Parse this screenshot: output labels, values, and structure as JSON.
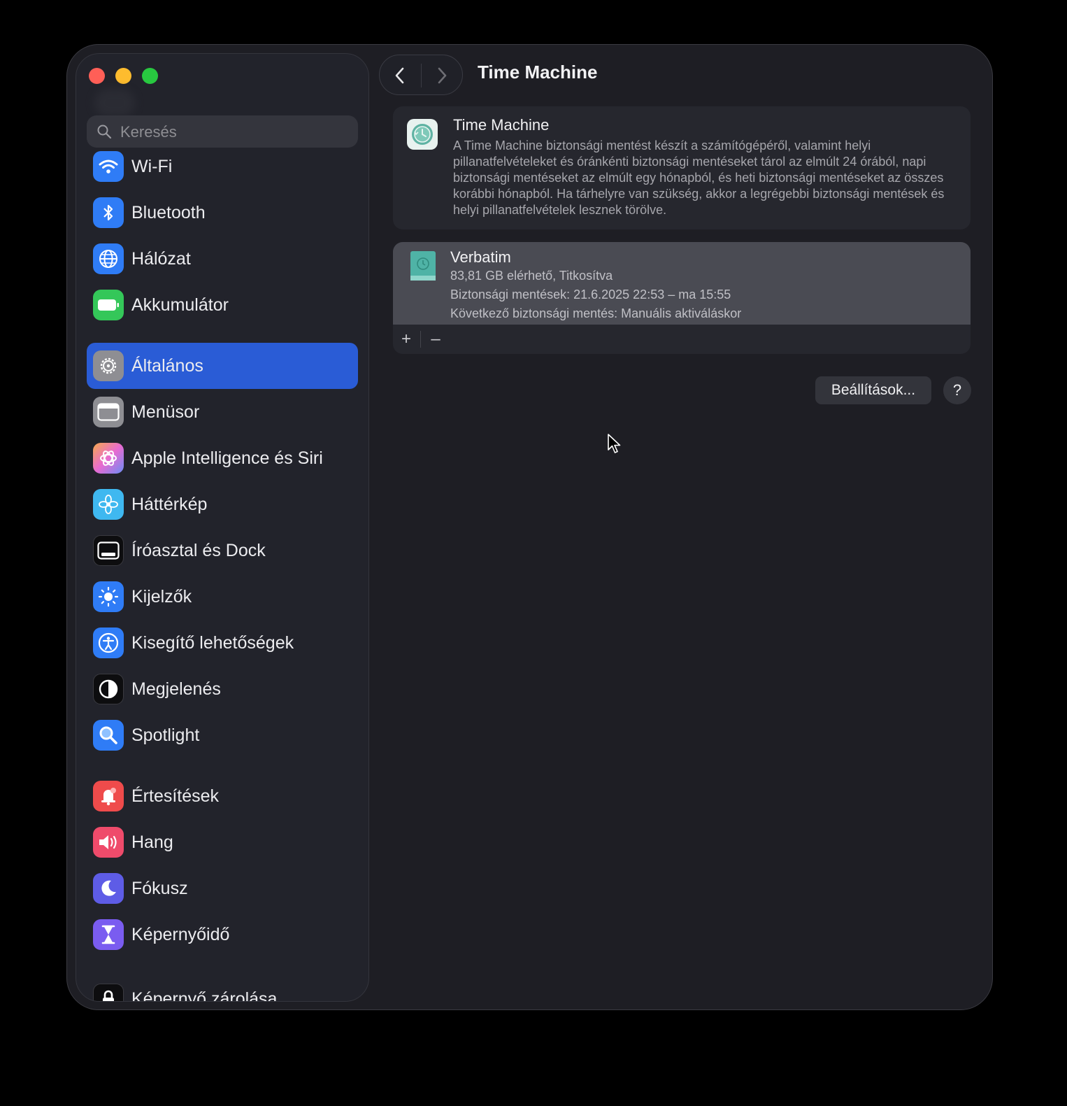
{
  "window": {
    "title": "Time Machine"
  },
  "search": {
    "placeholder": "Keresés"
  },
  "sidebar": {
    "items": [
      {
        "label": "Wi-Fi",
        "icon": "wifi-icon",
        "color": "#2f7cf6"
      },
      {
        "label": "Bluetooth",
        "icon": "bluetooth-icon",
        "color": "#2f7cf6"
      },
      {
        "label": "Hálózat",
        "icon": "globe-icon",
        "color": "#2f7cf6"
      },
      {
        "label": "Akkumulátor",
        "icon": "battery-icon",
        "color": "#34c759"
      },
      {
        "label": "Általános",
        "icon": "gear-icon",
        "color": "#8e8e93",
        "active": true
      },
      {
        "label": "Menüsor",
        "icon": "menubar-icon",
        "color": "#8e8e93"
      },
      {
        "label": "Apple Intelligence és Siri",
        "icon": "apple-intelligence-icon",
        "color": "#e86bd1"
      },
      {
        "label": "Háttérkép",
        "icon": "flower-icon",
        "color": "#3fb8f0"
      },
      {
        "label": "Íróasztal és Dock",
        "icon": "dock-icon",
        "color": "#111111"
      },
      {
        "label": "Kijelzők",
        "icon": "sun-icon",
        "color": "#2f7cf6"
      },
      {
        "label": "Kisegítő lehetőségek",
        "icon": "accessibility-icon",
        "color": "#2f7cf6"
      },
      {
        "label": "Megjelenés",
        "icon": "appearance-icon",
        "color": "#111111"
      },
      {
        "label": "Spotlight",
        "icon": "magnifier-icon",
        "color": "#2f7cf6"
      },
      {
        "label": "Értesítések",
        "icon": "bell-icon",
        "color": "#ef4b4b"
      },
      {
        "label": "Hang",
        "icon": "speaker-icon",
        "color": "#ef4b6b"
      },
      {
        "label": "Fókusz",
        "icon": "moon-icon",
        "color": "#5e5ce6"
      },
      {
        "label": "Képernyőidő",
        "icon": "hourglass-icon",
        "color": "#7a5cf0"
      },
      {
        "label": "Képernyő zárolása",
        "icon": "lock-icon",
        "color": "#111111"
      }
    ]
  },
  "main": {
    "title": "Time Machine",
    "info": {
      "title": "Time Machine",
      "description": "A Time Machine biztonsági mentést készít a számítógépéről, valamint helyi pillanatfelvételeket és óránkénti biztonsági mentéseket tárol az elmúlt 24 órából, napi biztonsági mentéseket az elmúlt egy hónapból, és heti biztonsági mentéseket az összes korábbi hónapból. Ha tárhelyre van szükség, akkor a legrégebbi biztonsági mentések és helyi pillanatfelvételek lesznek törölve."
    },
    "disk": {
      "name": "Verbatim",
      "capacity": "83,81 GB elérhető, Titkosítva",
      "backups": "Biztonsági mentések: 21.6.2025 22:53 – ma 15:55",
      "next": "Következő biztonsági mentés: Manuális aktiváláskor"
    },
    "controls": {
      "add": "+",
      "remove": "–"
    },
    "settings_button": "Beállítások...",
    "help_button": "?"
  },
  "colors": {
    "accent": "#2a5cd6",
    "background": "#1e1e24"
  }
}
